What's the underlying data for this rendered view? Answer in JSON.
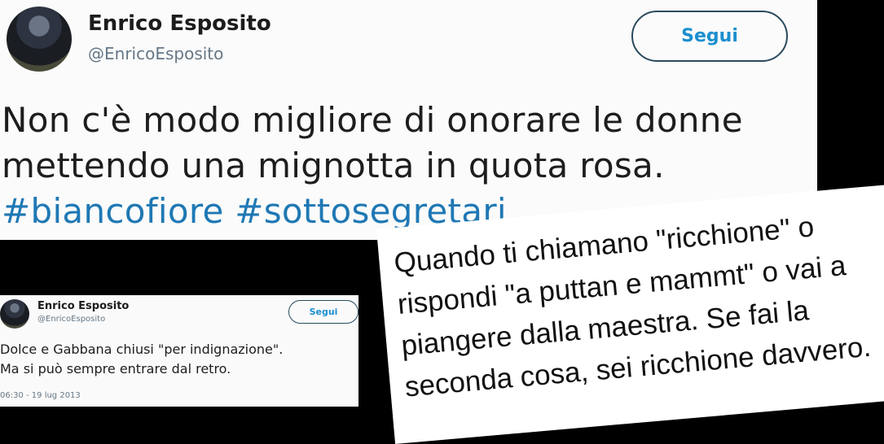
{
  "main_tweet": {
    "author_name": "Enrico Esposito",
    "author_handle": "@EnricoEsposito",
    "follow_label": "Segui",
    "text_line1": "Non c'è modo migliore di onorare le donne",
    "text_line2": "mettendo una mignotta in quota rosa.",
    "hashtags": "#biancofiore #sottosegretari"
  },
  "small_tweet": {
    "author_name": "Enrico Esposito",
    "author_handle": "@EnricoEsposito",
    "follow_label": "Segui",
    "text_line1": "Dolce e Gabbana chiusi \"per indignazione\".",
    "text_line2": "Ma si può sempre entrare dal retro.",
    "timestamp": "06:30 - 19 lug 2013"
  },
  "quote_card": {
    "line1": "Quando ti chiamano \"ricchione\" o",
    "line2": "rispondi \"a puttan e mammt\" o vai a",
    "line3": "piangere dalla maestra. Se fai la",
    "line4": "seconda cosa, sei ricchione davvero."
  },
  "colors": {
    "background": "#000000",
    "accent_blue": "#1b8fcf",
    "hashtag_blue": "#1f78b4",
    "handle_gray": "#657786"
  }
}
